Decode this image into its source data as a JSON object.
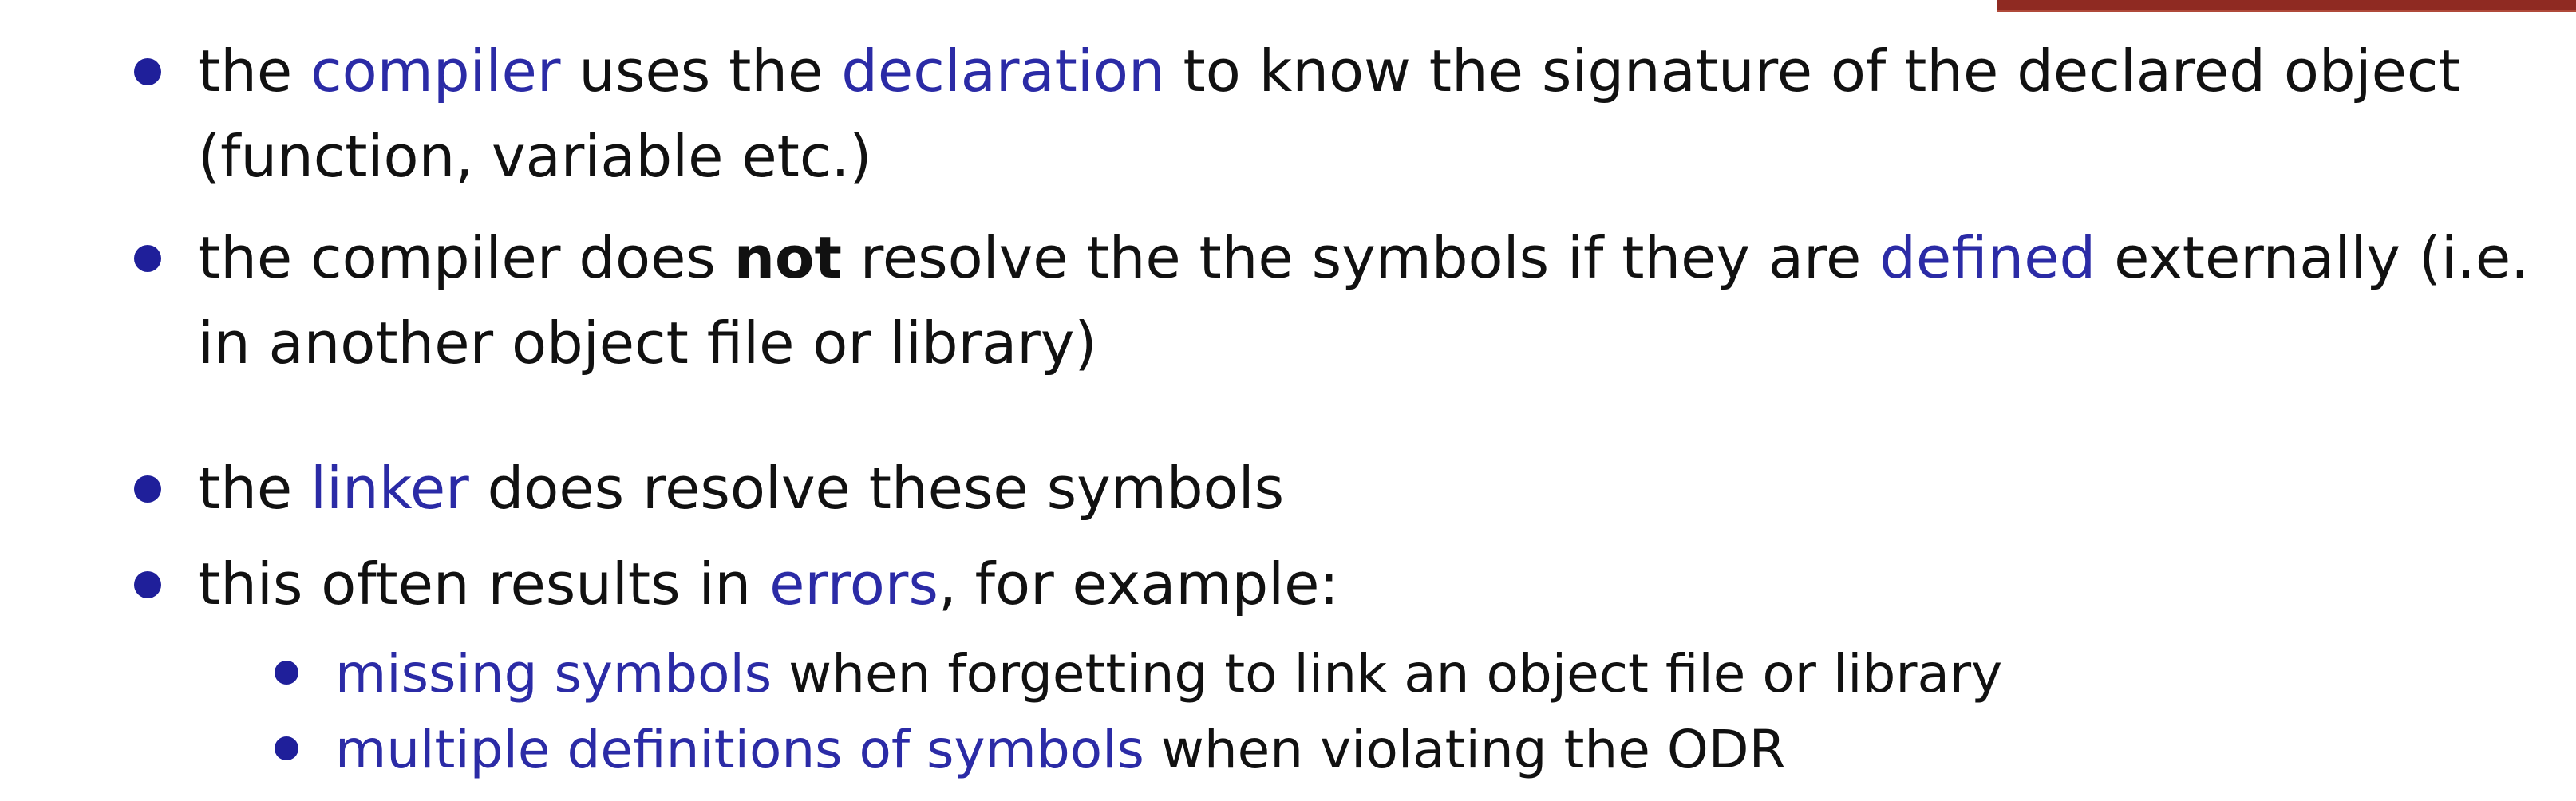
{
  "colors": {
    "highlight": "#2b2ba6",
    "bullet": "#1f1f9a",
    "text": "#111111",
    "corner_bar": "#8f2a22"
  },
  "items": [
    {
      "line1": {
        "t1": "the ",
        "h1": "compiler",
        "t2": " uses the ",
        "h2": "declaration",
        "t3": " to know the signature of the declared object"
      },
      "line2": "(function, variable etc.)"
    },
    {
      "line1": {
        "t1": "the compiler does ",
        "bold": "not",
        "t2": " resolve the the symbols if they are ",
        "h1": "defined",
        "t3": " externally (i.e."
      },
      "line2": "in another object file or library)"
    },
    {
      "t1": "the ",
      "h1": "linker",
      "t2": " does resolve these symbols"
    },
    {
      "t1": "this often results in ",
      "h1": "errors",
      "t2": ", for example:"
    }
  ],
  "subitems": [
    {
      "h1": "missing symbols",
      "t1": " when forgetting to link an object file or library"
    },
    {
      "h1": "multiple definitions of symbols",
      "t1": " when violating the ODR"
    }
  ]
}
